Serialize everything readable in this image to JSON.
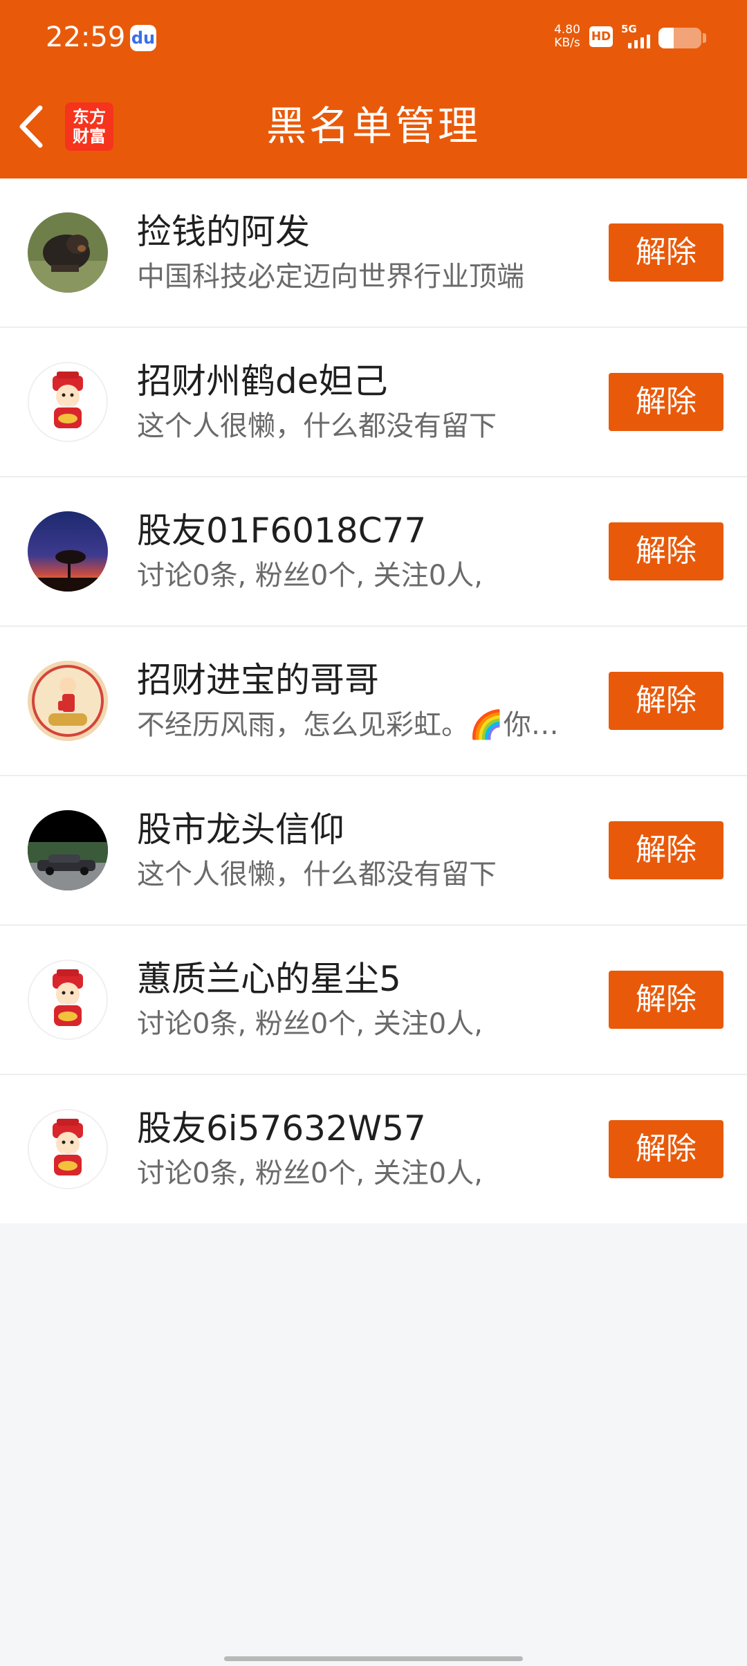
{
  "status_bar": {
    "time": "22:59",
    "baidu_glyph": "du",
    "net_speed_value": "4.80",
    "net_speed_unit": "KB/s",
    "hd": "HD",
    "network": "5G",
    "battery_level": 0.35
  },
  "header": {
    "title": "黑名单管理",
    "logo_line1": "东方",
    "logo_line2": "财富",
    "back_icon": "chevron-left-icon"
  },
  "colors": {
    "brand": "#e85a0a",
    "logo_red": "#f6331c",
    "background": "#f5f6f8"
  },
  "blacklist": [
    {
      "name": "捡钱的阿发",
      "bio": "中国科技必定迈向世界行业顶端",
      "action": "解除",
      "avatar": "dog-photo"
    },
    {
      "name": "招财州鹤de妲己",
      "bio": "这个人很懒，什么都没有留下",
      "action": "解除",
      "avatar": "god-of-wealth"
    },
    {
      "name": "股友01F6018C77",
      "bio": "讨论0条, 粉丝0个, 关注0人,",
      "action": "解除",
      "avatar": "sunset-tree"
    },
    {
      "name": "招财进宝的哥哥",
      "bio": "不经历风雨，怎么见彩虹。🌈你…",
      "action": "解除",
      "avatar": "kid-on-horse"
    },
    {
      "name": "股市龙头信仰",
      "bio": "这个人很懒，什么都没有留下",
      "action": "解除",
      "avatar": "car-photo"
    },
    {
      "name": "蕙质兰心的星尘5",
      "bio": "讨论0条, 粉丝0个, 关注0人,",
      "action": "解除",
      "avatar": "god-of-wealth"
    },
    {
      "name": "股友6i57632W57",
      "bio": "讨论0条, 粉丝0个, 关注0人,",
      "action": "解除",
      "avatar": "god-of-wealth"
    }
  ]
}
